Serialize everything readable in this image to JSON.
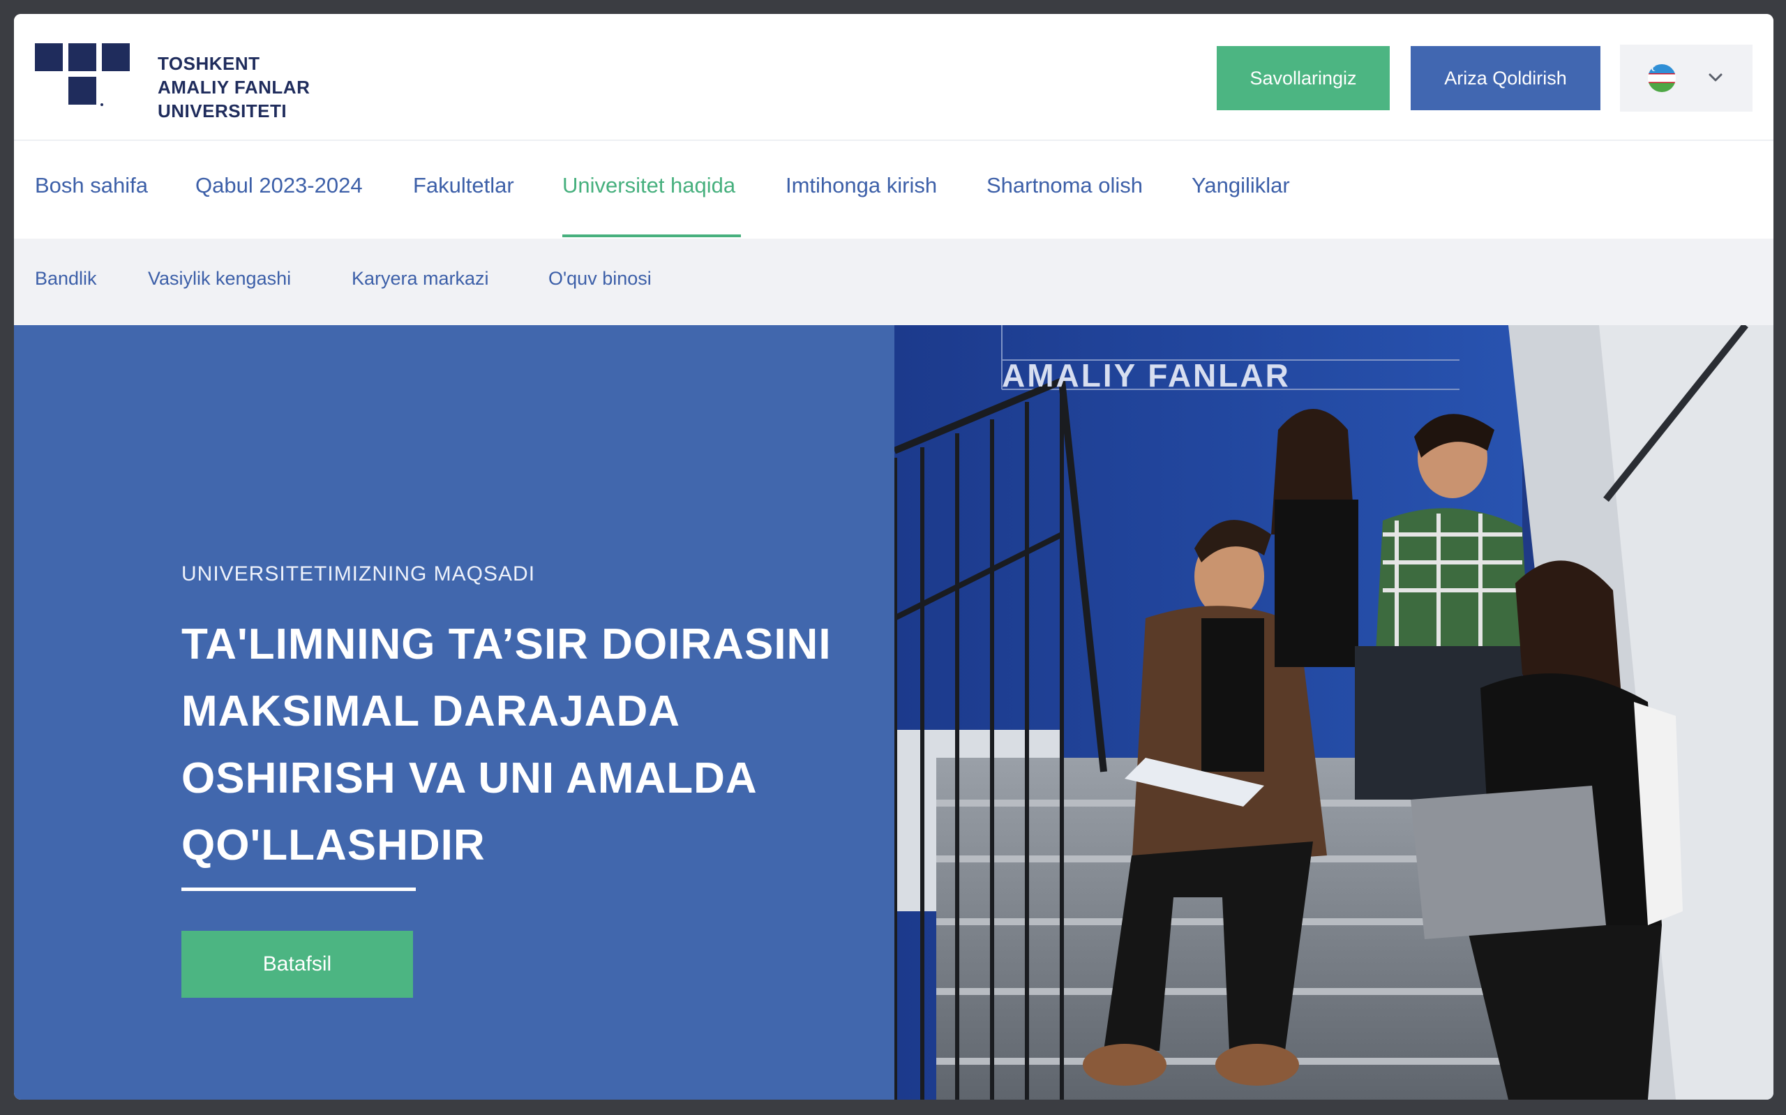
{
  "header": {
    "logo": {
      "line1": "TOSHKENT",
      "line2": "AMALIY FANLAR",
      "line3": "UNIVERSITETI"
    },
    "questions_button": "Savollaringiz",
    "apply_button": "Ariza Qoldirish",
    "language_selector": {
      "flag_icon": "uzbekistan-flag-icon",
      "chevron_icon": "chevron-down-icon"
    }
  },
  "main_nav": {
    "items": [
      {
        "label": "Bosh sahifa"
      },
      {
        "label": "Qabul 2023-2024"
      },
      {
        "label": "Fakultetlar"
      },
      {
        "label": "Universitet haqida",
        "active": true
      },
      {
        "label": "Imtihonga kirish"
      },
      {
        "label": "Shartnoma olish"
      },
      {
        "label": "Yangiliklar"
      }
    ]
  },
  "sub_nav": {
    "items": [
      {
        "label": "Bandlik"
      },
      {
        "label": "Vasiylik kengashi"
      },
      {
        "label": "Karyera markazi"
      },
      {
        "label": "O'quv binosi"
      }
    ]
  },
  "hero": {
    "eyebrow": "UNIVERSITETIMIZNING MAQSADI",
    "headline": "TA'LIMNING TA’SIR DOIRASINI MAKSIMAL DARAJADA OSHIRISH VA UNI AMALDA QO'LLASHDIR",
    "cta_button": "Batafsil",
    "photo_sign": "AMALIY FANLAR"
  },
  "colors": {
    "brand_navy": "#1f2c5c",
    "accent_green": "#4cb582",
    "accent_blue": "#4167b1",
    "nav_text": "#3c5fa8",
    "hero_blue": "#4167ad"
  }
}
